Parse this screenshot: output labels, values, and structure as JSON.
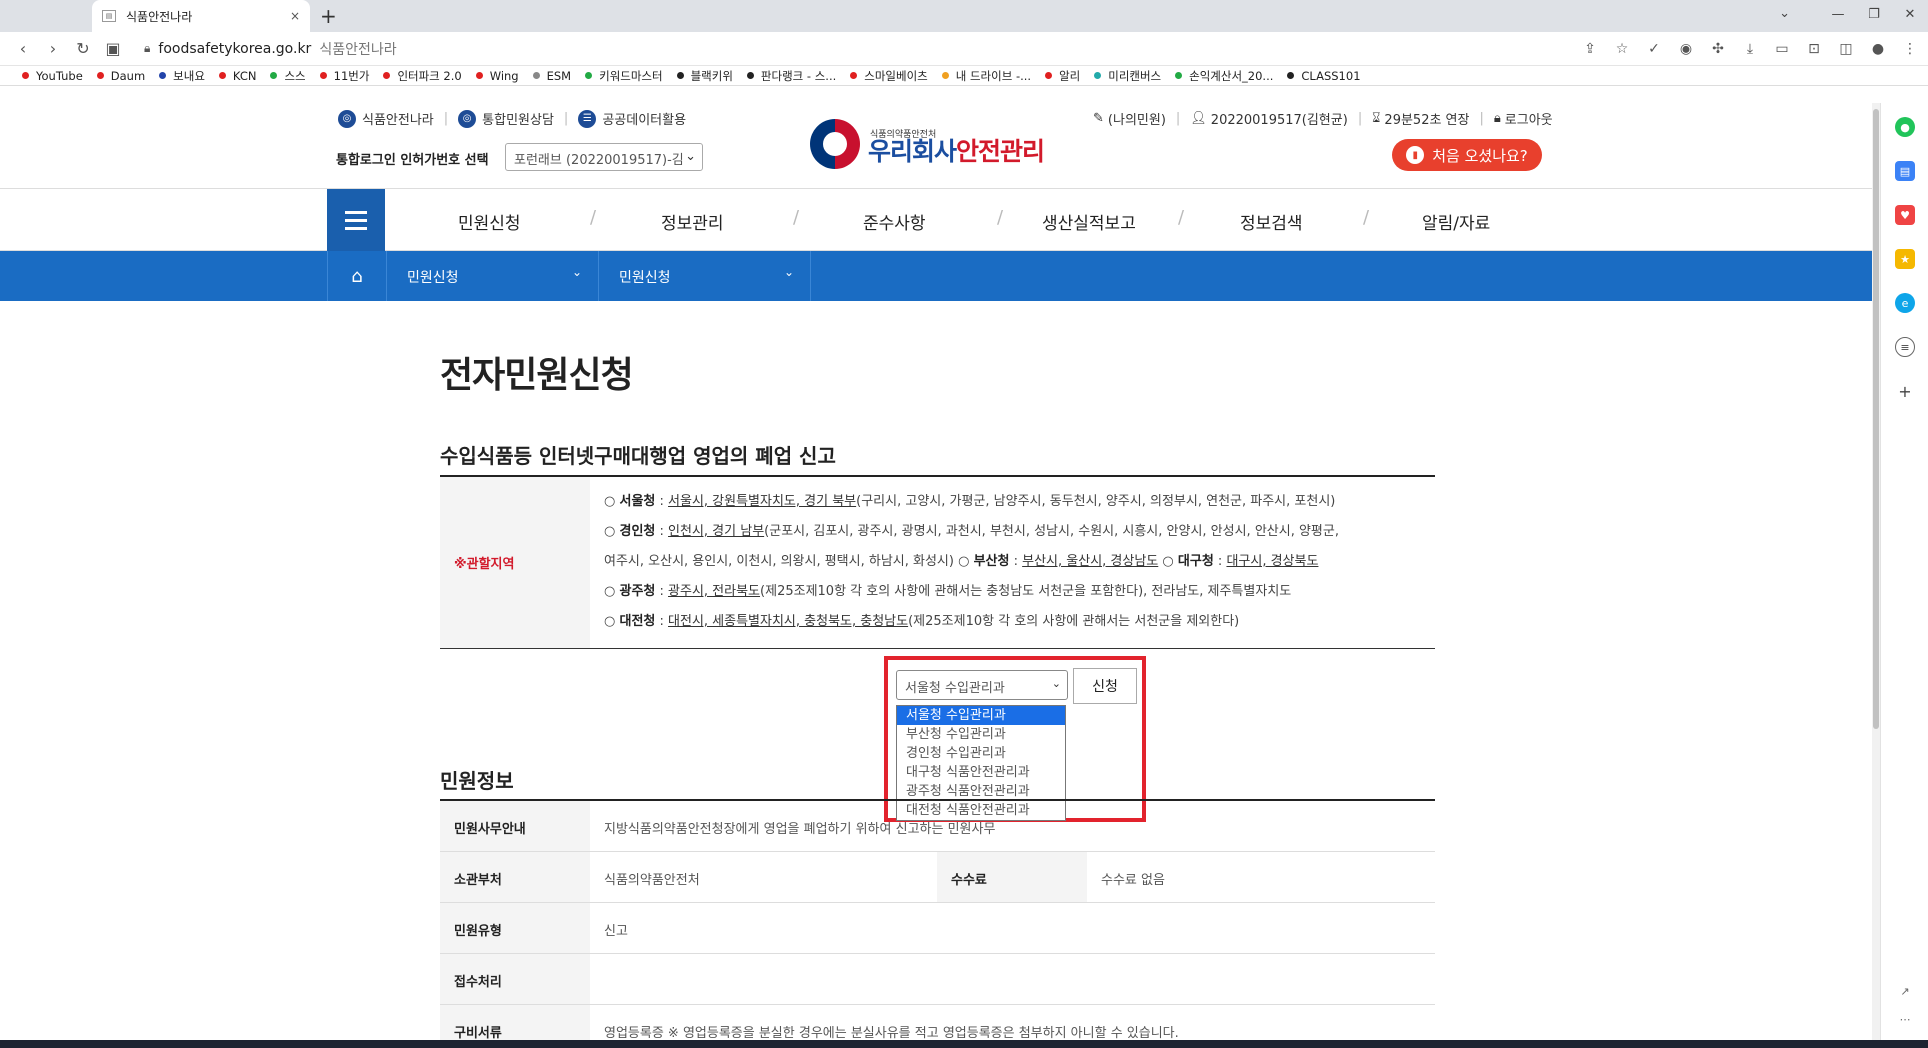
{
  "browser": {
    "tab_title": "식품안전나라",
    "tab_close": "×",
    "new_tab": "+",
    "url_host": "foodsafetykorea.go.kr",
    "url_title": "식품안전나라",
    "bookmarks": [
      {
        "label": "YouTube",
        "color": "#e02020"
      },
      {
        "label": "Daum",
        "color": "#e02020"
      },
      {
        "label": "보내요",
        "color": "#2244aa"
      },
      {
        "label": "KCN",
        "color": "#e02020"
      },
      {
        "label": "스스",
        "color": "#22aa44"
      },
      {
        "label": "11번가",
        "color": "#e02020"
      },
      {
        "label": "인터파크 2.0",
        "color": "#e02020"
      },
      {
        "label": "Wing",
        "color": "#e02020"
      },
      {
        "label": "ESM",
        "color": "#888888"
      },
      {
        "label": "키워드마스터",
        "color": "#22aa44"
      },
      {
        "label": "블랙키위",
        "color": "#222222"
      },
      {
        "label": "판다랭크 - 스...",
        "color": "#222222"
      },
      {
        "label": "스마일베이츠",
        "color": "#e02020"
      },
      {
        "label": "내 드라이브 -...",
        "color": "#f0a020"
      },
      {
        "label": "알리",
        "color": "#e02020"
      },
      {
        "label": "미리캔버스",
        "color": "#22aaaa"
      },
      {
        "label": "손익계산서_20...",
        "color": "#22aa44"
      },
      {
        "label": "CLASS101",
        "color": "#222222"
      }
    ]
  },
  "header": {
    "links": [
      "식품안전나라",
      "통합민원상담",
      "공공데이터활용"
    ],
    "login_label": "통합로그인 인허가번호 선택",
    "login_select": "포런래브 (20220019517)-김",
    "user_links": [
      "(나의민원)",
      "20220019517(김현균)",
      "29분52초 연장",
      "로그아웃"
    ],
    "logo_small": "식품의약품안전처",
    "logo_blue": "우리회사",
    "logo_red": "안전관리",
    "first_visit": "처음 오셨나요?"
  },
  "gnb": [
    "민원신청",
    "정보관리",
    "준수사항",
    "생산실적보고",
    "정보검색",
    "알림/자료"
  ],
  "lnb": [
    "민원신청",
    "민원신청"
  ],
  "page_title": "전자민원신청",
  "section_title": "수입식품등 인터넷구매대행업 영업의 폐업 신고",
  "region": {
    "label": "※관할지역",
    "lines": [
      {
        "office": "서울청",
        "areas": "서울시, 강원특별자치도, 경기 북부",
        "note": "(구리시, 고양시, 가평군, 남양주시, 동두천시, 양주시, 의정부시, 연천군, 파주시, 포천시)"
      },
      {
        "office": "경인청",
        "areas": "인천시, 경기 남부",
        "note": "(군포시, 김포시, 광주시, 광명시, 과천시, 부천시, 성남시, 수원시, 시흥시, 안양시, 안성시, 안산시, 양평군,"
      },
      {
        "office": "",
        "areas": "",
        "note": "여주시, 오산시, 용인시, 이천시, 의왕시, 평택시, 하남시, 화성시)"
      },
      {
        "office": "광주청",
        "areas": "광주시, 전라북도",
        "note": "(제25조제10항 각 호의 사항에 관해서는 충청남도 서천군을 포함한다), 전라남도, 제주특별자치도"
      },
      {
        "office": "대전청",
        "areas": "대전시, 세종특별자치시, 충청북도, 충청남도",
        "note": "(제25조제10항 각 호의 사항에 관해서는 서천군을 제외한다)"
      }
    ],
    "busan": {
      "office": "부산청",
      "areas": "부산시, 울산시, 경상남도"
    },
    "daegu": {
      "office": "대구청",
      "areas": "대구시, 경상북도"
    }
  },
  "select": {
    "value": "서울청 수입관리과",
    "options": [
      "서울청 수입관리과",
      "부산청 수입관리과",
      "경인청 수입관리과",
      "대구청 식품안전관리과",
      "광주청 식품안전관리과",
      "대전청 식품안전관리과"
    ],
    "apply": "신청"
  },
  "info_title": "민원정보",
  "info": {
    "guide_label": "민원사무안내",
    "guide_value": "지방식품의약품안전청장에게 영업을 폐업하기 위하여 신고하는 민원사무",
    "dept_label": "소관부처",
    "dept_value": "식품의약품안전처",
    "fee_label": "수수료",
    "fee_value": "수수료 없음",
    "type_label": "민원유형",
    "type_value": "신고",
    "receipt_label": "접수처리",
    "receipt_value": "",
    "docs_label": "구비서류",
    "docs_value": "영업등록증 ※ 영업등록증을 분실한 경우에는 분실사유를 적고 영업등록증은 첨부하지 아니할 수 있습니다."
  }
}
